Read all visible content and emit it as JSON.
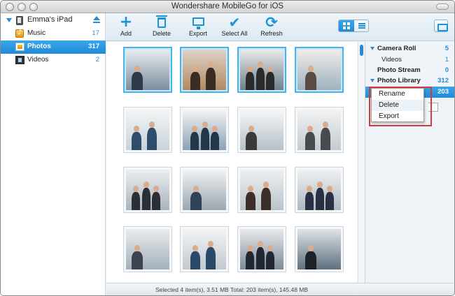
{
  "window": {
    "title": "Wondershare MobileGo for iOS"
  },
  "sidebar": {
    "device_name": "Emma's iPad",
    "items": [
      {
        "label": "Music",
        "count": "17",
        "icon": "music-icon"
      },
      {
        "label": "Photos",
        "count": "317",
        "icon": "photos-icon",
        "active": true
      },
      {
        "label": "Videos",
        "count": "2",
        "icon": "videos-icon"
      }
    ]
  },
  "toolbar": {
    "add_label": "Add",
    "delete_label": "Delete",
    "export_label": "Export",
    "select_all_label": "Select All",
    "refresh_label": "Refresh",
    "view_mode": "grid"
  },
  "albums": {
    "camera_roll_label": "Camera Roll",
    "camera_roll_count": "5",
    "videos_label": "Videos",
    "videos_count": "1",
    "photo_stream_label": "Photo Stream",
    "photo_stream_count": "0",
    "photo_library_label": "Photo Library",
    "photo_library_count": "312",
    "selected_album_count": "203"
  },
  "context_menu": {
    "rename_label": "Rename",
    "delete_label": "Delete",
    "export_label": "Export"
  },
  "photos": {
    "selected_indices": [
      0,
      1,
      2,
      3
    ],
    "total_thumbnails_shown": 16
  },
  "status": {
    "text": "Selected 4 item(s), 3.51 MB    Total: 203 item(s), 145.48 MB"
  },
  "colors": {
    "accent": "#2b8ad3",
    "selection": "#45b4ec",
    "highlight_outline": "#d23c3c"
  }
}
